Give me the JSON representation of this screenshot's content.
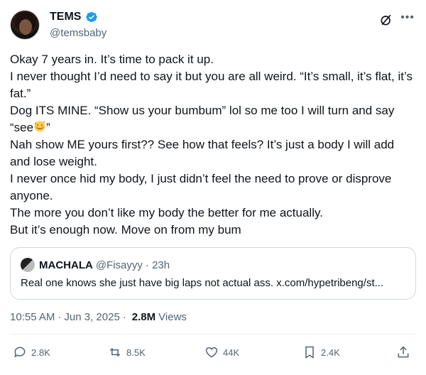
{
  "author": {
    "display_name": "TEMS",
    "handle": "@temsbaby",
    "avatar_icon": "profile-photo",
    "verified_color": "#1d9bf0"
  },
  "header_icons": [
    "grok-icon",
    "more-icon"
  ],
  "tweet": {
    "lines": [
      "Okay 7 years in. It’s time to pack it up.",
      "I never thought I’d need to say it but you are all weird. “It’s small, it’s flat, it’s fat.”",
      "Dog ITS MINE. “Show us your bumbum” lol so me too I will turn and say “see",
      "”",
      "Nah show ME yours first?? See how that feels? It’s just a body I will add and lose weight.",
      "I never once hid my body, I just didn’t feel the need to prove or disprove anyone.",
      "The more you don’t like my body the better for me actually.",
      "But it’s enough now. Move on from my bum"
    ],
    "emoji": "smiling-face-with-hearts"
  },
  "quote": {
    "name": "MACHALA",
    "handle": "@Fisayyy",
    "time": "· 23h",
    "text": "Real one knows she just have big laps not actual ass. x.com/hypetribeng/st..."
  },
  "meta": {
    "time": "10:55 AM",
    "date": "Jun 3, 2025",
    "views_count": "2.8M",
    "views_label": "Views",
    "separator": "·"
  },
  "actions": {
    "replies": "2.8K",
    "reposts": "8.5K",
    "likes": "44K",
    "bookmarks": "2.4K"
  }
}
